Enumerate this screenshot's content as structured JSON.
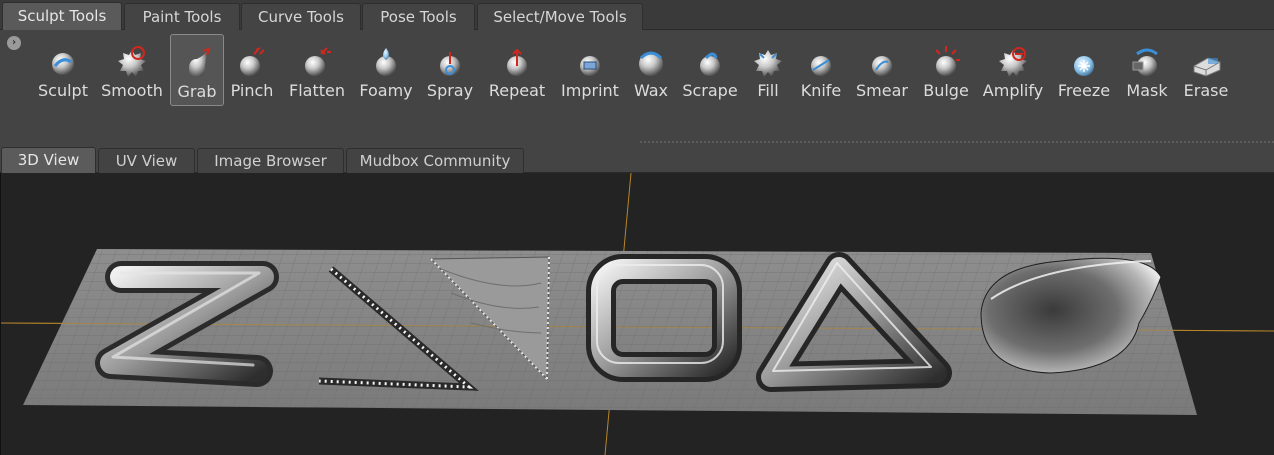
{
  "tool_tabs": [
    "Sculpt Tools",
    "Paint Tools",
    "Curve Tools",
    "Pose Tools",
    "Select/Move Tools"
  ],
  "tray": {
    "collapse_glyph": "›",
    "tools": [
      {
        "label": "Sculpt",
        "icon": "sculpt-icon"
      },
      {
        "label": "Smooth",
        "icon": "smooth-icon"
      },
      {
        "label": "Grab",
        "icon": "grab-icon",
        "selected": true
      },
      {
        "label": "Pinch",
        "icon": "pinch-icon"
      },
      {
        "label": "Flatten",
        "icon": "flatten-icon"
      },
      {
        "label": "Foamy",
        "icon": "foamy-icon"
      },
      {
        "label": "Spray",
        "icon": "spray-icon"
      },
      {
        "label": "Repeat",
        "icon": "repeat-icon"
      },
      {
        "label": "Imprint",
        "icon": "imprint-icon"
      },
      {
        "label": "Wax",
        "icon": "wax-icon"
      },
      {
        "label": "Scrape",
        "icon": "scrape-icon"
      },
      {
        "label": "Fill",
        "icon": "fill-icon"
      },
      {
        "label": "Knife",
        "icon": "knife-icon"
      },
      {
        "label": "Smear",
        "icon": "smear-icon"
      },
      {
        "label": "Bulge",
        "icon": "bulge-icon"
      },
      {
        "label": "Amplify",
        "icon": "amplify-icon"
      },
      {
        "label": "Freeze",
        "icon": "freeze-icon"
      },
      {
        "label": "Mask",
        "icon": "mask-icon"
      },
      {
        "label": "Erase",
        "icon": "erase-icon"
      }
    ]
  },
  "view_tabs": [
    "3D View",
    "UV View",
    "Image Browser",
    "Mudbox Community"
  ],
  "colors": {
    "accent_red": "#d0281e",
    "accent_blue": "#3a8fd8",
    "axis_orange": "#b8862a",
    "viewport_bg": "#232323"
  }
}
